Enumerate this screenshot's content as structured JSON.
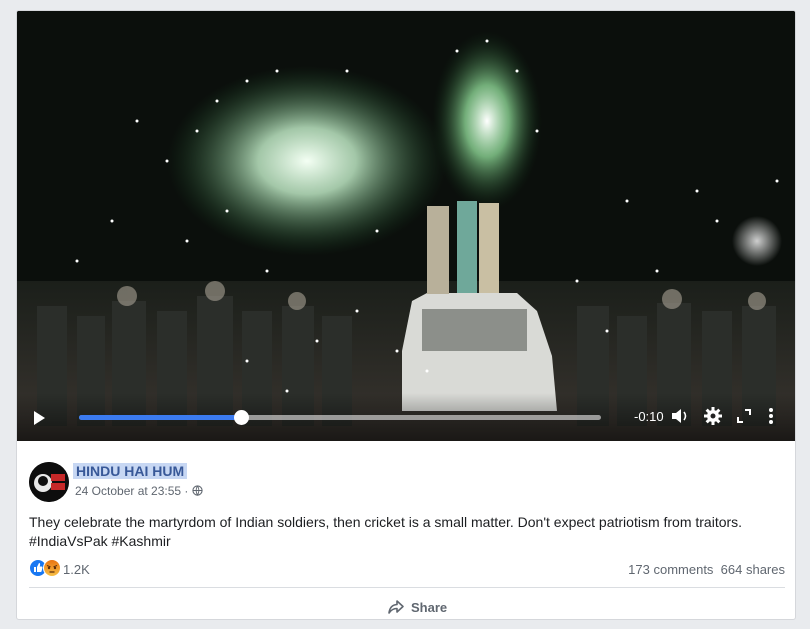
{
  "video": {
    "time_remaining": "-0:10",
    "progress_fraction": 0.31
  },
  "post": {
    "page_name": "HINDU HAI HUM",
    "timestamp": "24 October at 23:55",
    "separator": " · ",
    "avatar_text": "हिंदु हम",
    "text": "They celebrate the martyrdom of Indian soldiers, then cricket is a small matter. Don't expect patriotism from traitors.",
    "hashtags": [
      "#IndiaVsPak",
      "#Kashmir"
    ],
    "reactions": {
      "count": "1.2K",
      "icons": [
        "like-icon",
        "angry-icon"
      ]
    },
    "comments": "173 comments",
    "shares": "664 shares",
    "share_label": "Share"
  },
  "colors": {
    "link": "#385898",
    "highlight": "#c7d7f3",
    "progress": "#3b7bf0"
  }
}
